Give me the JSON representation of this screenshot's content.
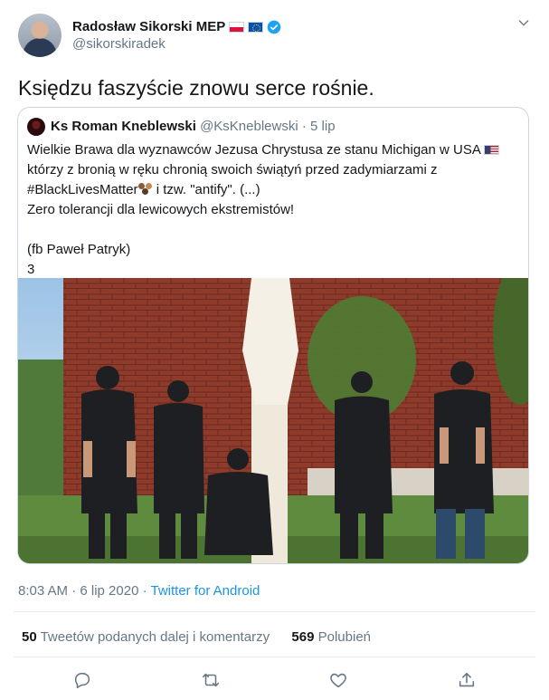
{
  "author": {
    "name": "Radosław Sikorski MEP",
    "handle": "@sikorskiradek",
    "flags": [
      "flag-poland",
      "flag-eu"
    ],
    "verified_icon": "verified-badge-icon"
  },
  "tweet": {
    "text": "Księdzu faszyście znowu serce rośnie."
  },
  "quoted": {
    "name": "Ks Roman Kneblewski",
    "handle": "@KsKneblewski",
    "separator": "·",
    "date": "5 lip",
    "line1": "Wielkie Brawa dla wyznawców Jezusa Chrystusa ze stanu Michigan w USA",
    "line2": "którzy z bronią w ręku chronią swoich świątyń przed zadymiarzami z",
    "line3a": "#BlackLivesMatter",
    "line3b": " i tzw. \"antify\".  (...)",
    "line4": "Zero tolerancji dla lewicowych ekstremistów!",
    "line5": "(fb Paweł Patryk)",
    "line6": "3"
  },
  "footer": {
    "time": "8:03 AM · 6 lip 2020 · ",
    "source": "Twitter for Android"
  },
  "stats": {
    "retweets_count": "50",
    "retweets_label": "Tweetów podanych dalej i komentarzy",
    "likes_count": "569",
    "likes_label": "Polubień"
  },
  "actions": [
    "reply-icon",
    "retweet-icon",
    "like-icon",
    "share-icon"
  ],
  "colors": {
    "link": "#1b95e0",
    "muted": "#657786",
    "border": "#ccd6dd"
  }
}
